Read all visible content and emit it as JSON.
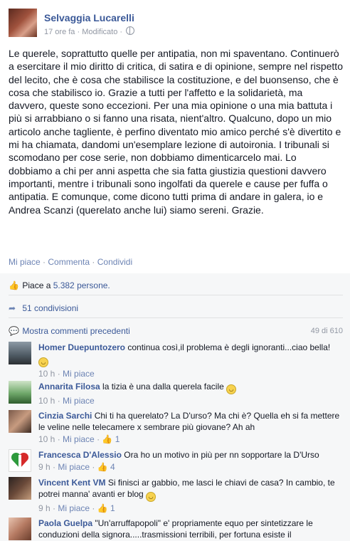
{
  "post": {
    "author": "Selvaggia Lucarelli",
    "time": "17 ore fa",
    "modified": "Modificato",
    "text": "Le querele, soprattutto quelle per antipatia, non mi spaventano. Continuerò a esercitare il mio diritto di critica, di satira e di opinione, sempre nel rispetto del lecito, che è cosa che stabilisce la costituzione, e del buonsenso, che è cosa che stabilisco io. Grazie a tutti per l'affetto e la solidarietà, ma davvero, queste sono eccezioni. Per una mia opinione o una mia battuta i più si arrabbiano o si fanno una risata, nient'altro. Qualcuno, dopo un mio articolo anche tagliente, è perfino diventato mio amico perché s'è divertito e mi ha chiamata, dandomi un'esemplare lezione di autoironia. I tribunali si scomodano per cose serie, non dobbiamo dimenticarcelo mai. Lo dobbiamo a chi per anni aspetta che sia fatta giustizia questioni davvero importanti, mentre i tribunali sono ingolfati da querele e cause per fuffa o antipatia. E comunque, come dicono tutti prima di andare in galera, io e Andrea Scanzi (querelato anche lui) siamo sereni. Grazie."
  },
  "actions": {
    "like": "Mi piace",
    "comment": "Commenta",
    "share": "Condividi",
    "separator": "·"
  },
  "stats": {
    "likes_prefix": "Piace a ",
    "likes_link": "5.382 persone.",
    "shares": "51 condivisioni",
    "previous_comments": "Mostra commenti precedenti",
    "comment_count": "49 di 610"
  },
  "comments": [
    {
      "name": "Homer Duepuntozero",
      "text": "continua così,il problema è degli ignoranti...ciao bella!",
      "time": "10 h",
      "like_label": "Mi piace",
      "likes": ""
    },
    {
      "name": "Annarita Filosa",
      "text": "la tizia è una dalla querela facile",
      "time": "10 h",
      "like_label": "Mi piace",
      "likes": ""
    },
    {
      "name": "Cinzia Sarchi",
      "text": "Chi ti ha querelato? La D'urso? Ma chi è? Quella eh si fa mettere le veline nelle telecamere x sembrare più giovane? Ah ah",
      "time": "10 h",
      "like_label": "Mi piace",
      "likes": "1"
    },
    {
      "name": "Francesca D'Alessio",
      "text": "Ora ho un motivo in più per nn sopportare la D'Urso",
      "time": "9 h",
      "like_label": "Mi piace",
      "likes": "4"
    },
    {
      "name": "Vincent Kent VM",
      "text": "Si finisci ar gabbio, me lasci le chiavi de casa? In cambio, te potrei manna' avanti er blog",
      "time": "9 h",
      "like_label": "Mi piace",
      "likes": "1"
    },
    {
      "name": "Paola Guelpa",
      "text": "\"Un'arruffapopoli\" e' propriamente equo per sintetizzare le conduzioni della signora.....trasmissioni terribili, per fortuna esiste il",
      "time": "",
      "like_label": "",
      "likes": ""
    }
  ],
  "colors": {
    "link": "#3b5998",
    "muted": "#9197a3",
    "action": "#6d84b4",
    "comments_bg": "#f6f7f8"
  }
}
